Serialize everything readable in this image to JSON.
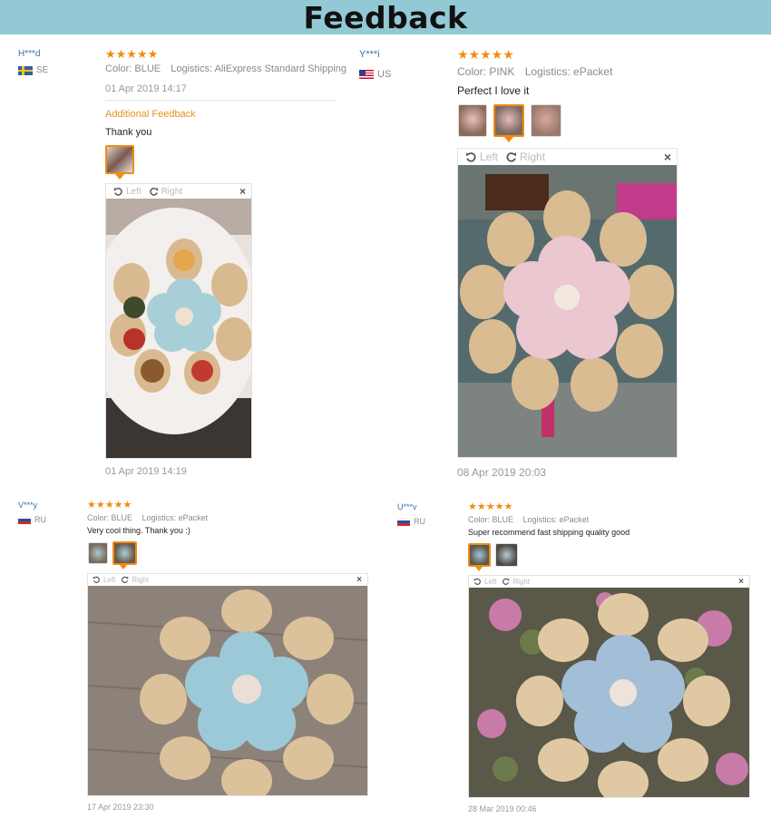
{
  "banner": {
    "title": "Feedback"
  },
  "reviews": [
    {
      "user": "H***d",
      "country": "SE",
      "stars": "★★★★★",
      "color_label": "Color: BLUE",
      "logistics_label": "Logistics: AliExpress Standard Shipping",
      "date": "01 Apr 2019 14:17",
      "additional_label": "Additional Feedback",
      "text": "Thank you",
      "viewer": {
        "left": "Left",
        "right": "Right",
        "close": "×"
      },
      "photo_date": "01 Apr 2019 14:19"
    },
    {
      "user": "Y***i",
      "country": "US",
      "stars": "★★★★★",
      "color_label": "Color: PINK",
      "logistics_label": "Logistics: ePacket",
      "text": "Perfect I love it",
      "viewer": {
        "left": "Left",
        "right": "Right",
        "close": "×"
      },
      "date": "08 Apr 2019 20:03"
    },
    {
      "user": "V***y",
      "country": "RU",
      "stars": "★★★★★",
      "color_label": "Color: BLUE",
      "logistics_label": "Logistics: ePacket",
      "text": "Very cool thing. Thank you :)",
      "viewer": {
        "left": "Left",
        "right": "Right",
        "close": "×"
      },
      "date": "17 Apr 2019 23:30"
    },
    {
      "user": "U***v",
      "country": "RU",
      "stars": "★★★★★",
      "color_label": "Color: BLUE",
      "logistics_label": "Logistics: ePacket",
      "text": "Super recommend fast shipping quality good",
      "viewer": {
        "left": "Left",
        "right": "Right",
        "close": "×"
      },
      "date": "28 Mar 2019 00:46"
    }
  ],
  "colors": {
    "banner": "#93c9d5",
    "star": "#f08c12",
    "user_link": "#3a6fb0",
    "additional": "#e69220"
  }
}
